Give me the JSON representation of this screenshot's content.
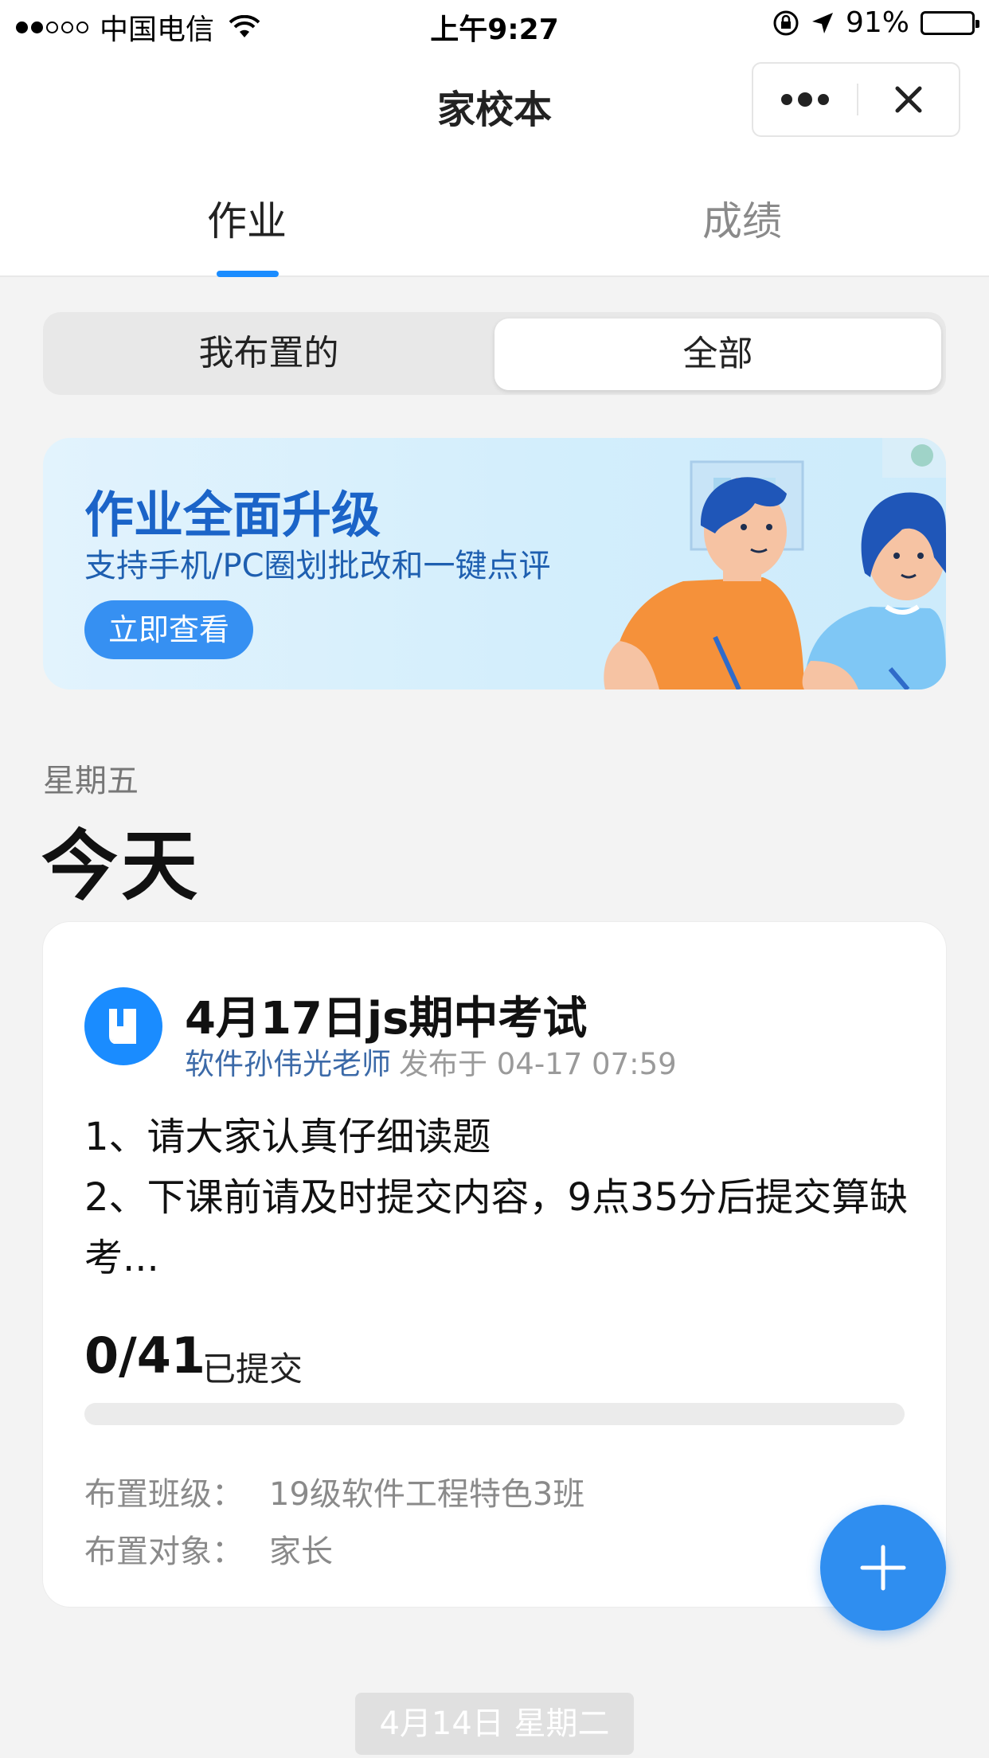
{
  "status_bar": {
    "carrier": "中国电信",
    "time": "上午9:27",
    "battery": "91%",
    "battery_level": 0.91
  },
  "nav": {
    "title": "家校本",
    "more_icon": "more-dots-icon",
    "close_icon": "close-icon"
  },
  "tabs": [
    {
      "label": "作业",
      "active": true
    },
    {
      "label": "成绩",
      "active": false
    }
  ],
  "segment": {
    "options": [
      "我布置的",
      "全部"
    ],
    "selected": "全部"
  },
  "banner": {
    "title": "作业全面升级",
    "subtitle": "支持手机/PC圈划批改和一键点评",
    "button": "立即查看"
  },
  "section": {
    "weekday": "星期五",
    "day": "今天"
  },
  "homework": {
    "title": "4月17日js期中考试",
    "teacher": "软件孙伟光老师",
    "published": "发布于 04-17 07:59",
    "desc_line1": "1、请大家认真仔细读题",
    "desc_line2": "2、下课前请及时提交内容，9点35分后提交算缺考...",
    "submitted_count": "0/41",
    "submitted_label": "已提交",
    "progress": 0,
    "class_label": "布置班级：",
    "class_value": "19级软件工程特色3班",
    "target_label": "布置对象：",
    "target_value": "家长"
  },
  "next_date": "4月14日  星期二",
  "colors": {
    "accent": "#1a8cff",
    "fab": "#2f8ef0",
    "banner_title": "#1b64c8"
  }
}
